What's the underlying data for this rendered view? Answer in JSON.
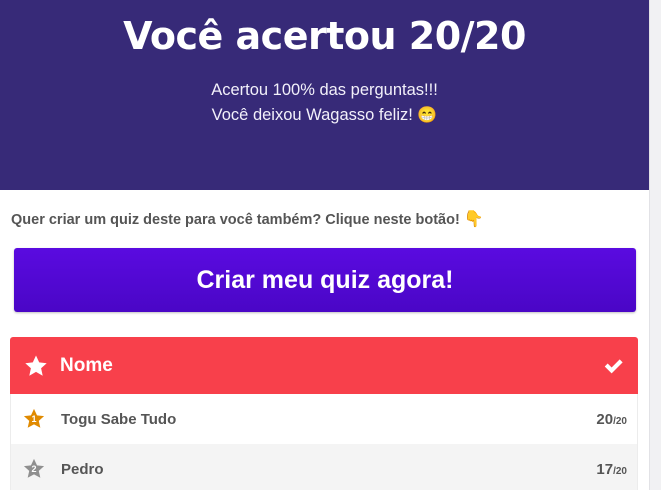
{
  "hero": {
    "title": "Você acertou 20/20",
    "line1": "Acertou 100% das perguntas!!!",
    "line2": "Você deixou Wagasso feliz!",
    "line2_emoji": "😁"
  },
  "prompt": {
    "text": "Quer criar um quiz deste para você também? Clique neste botão!",
    "emoji": "👇"
  },
  "cta": {
    "label": "Criar meu quiz agora!"
  },
  "leaderboard": {
    "header_label": "Nome",
    "header_icons": [
      "star-icon",
      "check-icon"
    ],
    "rows": [
      {
        "rank": "1",
        "name": "Togu Sabe Tudo",
        "score": "20",
        "total": "/20",
        "badge_color": "#e08a00"
      },
      {
        "rank": "2",
        "name": "Pedro",
        "score": "17",
        "total": "/20",
        "badge_color": "#8f8f8f"
      }
    ]
  },
  "colors": {
    "hero_bg": "#372a78",
    "cta_bg": "#5a0be0",
    "header_bg": "#f8404b"
  }
}
